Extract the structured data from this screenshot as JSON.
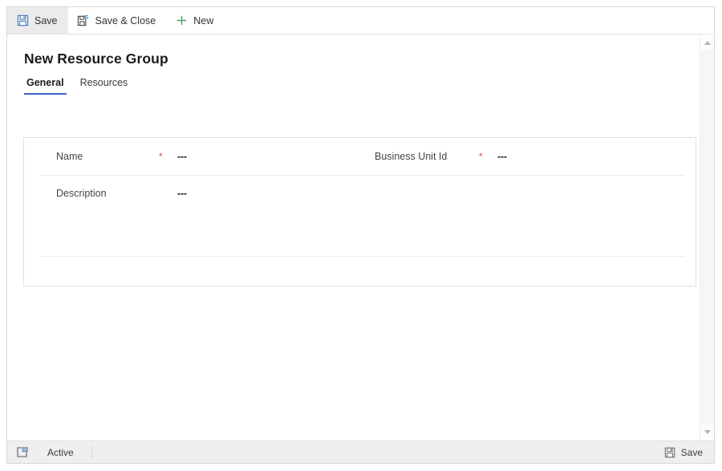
{
  "commandbar": {
    "buttons": [
      {
        "label": "Save",
        "icon": "save-icon",
        "active": true
      },
      {
        "label": "Save & Close",
        "icon": "save-and-close-icon",
        "active": false
      },
      {
        "label": "New",
        "icon": "plus-icon",
        "active": false
      }
    ]
  },
  "page": {
    "title": "New Resource Group"
  },
  "tabs": [
    {
      "label": "General",
      "selected": true
    },
    {
      "label": "Resources",
      "selected": false
    }
  ],
  "form": {
    "fields": [
      {
        "label": "Name",
        "required": true,
        "value": "---"
      },
      {
        "label": "Business Unit Id",
        "required": true,
        "value": "---"
      },
      {
        "label": "Description",
        "required": false,
        "value": "---"
      }
    ],
    "required_marker": "*"
  },
  "statusbar": {
    "popout_icon": "open-in-new-window-icon",
    "status": "Active",
    "save_label": "Save",
    "save_icon": "save-icon"
  },
  "colors": {
    "tab_accent": "#3a63c8",
    "required": "#e8453c",
    "new_icon": "#4aa564",
    "command_active_bg": "#ebebeb",
    "statusbar_bg": "#efefef"
  }
}
